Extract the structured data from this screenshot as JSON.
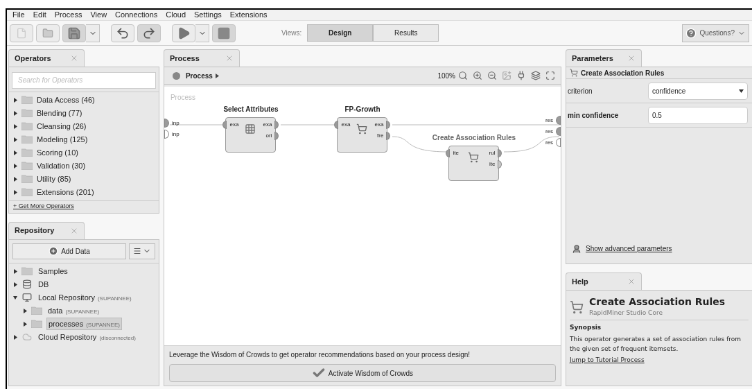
{
  "menu": [
    "File",
    "Edit",
    "Process",
    "View",
    "Connections",
    "Cloud",
    "Settings",
    "Extensions"
  ],
  "views": {
    "label": "Views:",
    "tabs": [
      {
        "label": "Design",
        "selected": true
      },
      {
        "label": "Results",
        "selected": false
      }
    ]
  },
  "questions": "Questions?",
  "operators": {
    "tab": "Operators",
    "search": {
      "placeholder": "Search for Operators"
    },
    "items": [
      {
        "label": "Data Access (46)",
        "expanded": false
      },
      {
        "label": "Blending (77)",
        "expanded": false
      },
      {
        "label": "Cleansing (26)",
        "expanded": false
      },
      {
        "label": "Modeling (125)",
        "expanded": false
      },
      {
        "label": "Scoring (10)",
        "expanded": false
      },
      {
        "label": "Validation (30)",
        "expanded": false
      },
      {
        "label": "Utility (85)",
        "expanded": false
      },
      {
        "label": "Extensions (201)",
        "expanded": false
      }
    ],
    "more_link": "+ Get More Operators"
  },
  "repository": {
    "tab": "Repository",
    "add_button": "Add Data",
    "items": [
      {
        "label": "Samples",
        "kind": "folder",
        "expanded": false,
        "selected": false
      },
      {
        "label": "DB",
        "kind": "database",
        "expanded": false,
        "selected": false
      },
      {
        "label": "Local Repository",
        "note": "(SUPANNEE)",
        "kind": "repository",
        "expanded": true,
        "selected": false,
        "children": [
          {
            "label": "data",
            "note": "(SUPANNEE)",
            "kind": "folder",
            "expanded": false,
            "selected": false
          },
          {
            "label": "processes",
            "note": "(SUPANNEE)",
            "kind": "folder",
            "expanded": false,
            "selected": true
          }
        ]
      },
      {
        "label": "Cloud Repository",
        "note": "(disconnected)",
        "kind": "cloud",
        "expanded": false,
        "selected": false
      }
    ]
  },
  "process": {
    "tab": "Process",
    "breadcrumb": "Process",
    "zoom": "100%",
    "canvas_label": "Process",
    "left_ports": [
      {
        "label": "inp",
        "connected": true
      },
      {
        "label": "inp",
        "connected": false
      }
    ],
    "right_ports": [
      {
        "label": "res",
        "connected": true
      },
      {
        "label": "res",
        "connected": true
      },
      {
        "label": "res",
        "connected": false
      }
    ],
    "operators": [
      {
        "title": "Select Attributes",
        "kind": "table",
        "inputs": [
          "exa"
        ],
        "outputs": [
          "exa",
          "ori"
        ],
        "selected": false
      },
      {
        "title": "FP-Growth",
        "kind": "cart",
        "inputs": [
          "exa"
        ],
        "outputs": [
          "exa",
          "fre"
        ],
        "selected": false
      },
      {
        "title": "Create Association Rules",
        "kind": "cart",
        "inputs": [
          "ite"
        ],
        "outputs": [
          "rul",
          "ite"
        ],
        "selected": true
      }
    ],
    "wisdom_text": "Leverage the Wisdom of Crowds to get operator recommendations based on your process design!",
    "wisdom_button": "Activate Wisdom of Crowds"
  },
  "parameters": {
    "tab": "Parameters",
    "operator": "Create Association Rules",
    "fields": [
      {
        "label": "criterion",
        "kind": "select",
        "value": "confidence",
        "bold": false
      },
      {
        "label": "min confidence",
        "kind": "text",
        "value": "0.5",
        "bold": true
      }
    ],
    "advanced_link": "Show advanced parameters"
  },
  "help": {
    "tab": "Help",
    "title": "Create Association Rules",
    "subtitle": "RapidMiner Studio Core",
    "section": "Synopsis",
    "text": "This operator generates a set of association rules from the given set of frequent itemsets.",
    "link": "Jump to Tutorial Process"
  }
}
